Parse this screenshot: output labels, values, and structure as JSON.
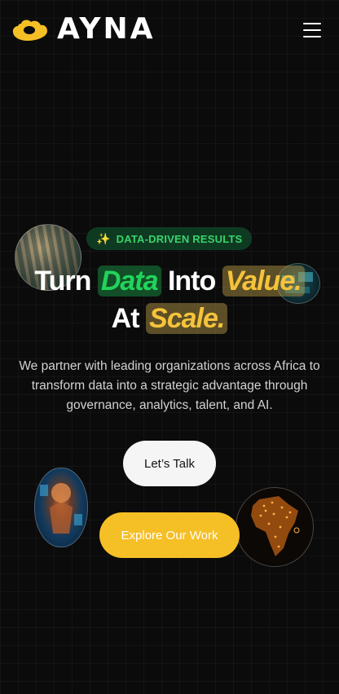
{
  "header": {
    "logo_text": "AYNA",
    "logo_icon": "cloud-blob-icon",
    "menu_icon": "hamburger-menu-icon",
    "brand_color": "#f5bf26"
  },
  "hero": {
    "badge": {
      "icon": "sparkles-icon",
      "icon_glyph": "✨",
      "label": "DATA-DRIVEN RESULTS"
    },
    "headline": {
      "turn": "Turn",
      "data": "Data",
      "into": "Into",
      "value": "Value.",
      "at": "At",
      "scale": "Scale."
    },
    "description": "We partner with leading organizations across Africa to transform data into a strategic advantage through governance, analytics, talent, and AI.",
    "buttons": {
      "talk": "Let’s Talk",
      "work": "Explore Our Work"
    }
  },
  "colors": {
    "accent_green": "#22d35b",
    "accent_yellow": "#f5c33b",
    "background": "#0b0b0b"
  }
}
